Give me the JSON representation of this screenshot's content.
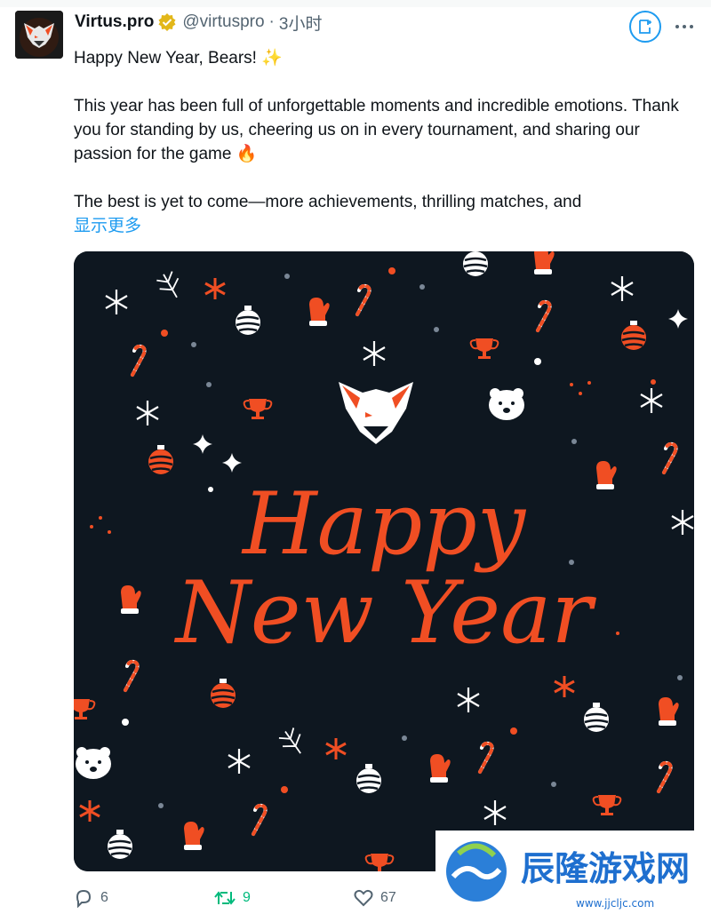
{
  "author": {
    "name": "Virtus.pro",
    "handle": "@virtuspro",
    "separator": "·",
    "time": "3小时",
    "avatar_icon": "vp-bear-logo"
  },
  "tweet": {
    "line1": "Happy New Year, Bears! ✨",
    "para2": "This year has been full of unforgettable moments and incredible emotions. Thank you for standing by us, cheering us on in every tournament, and sharing our passion for the game 🔥",
    "para3": "The best is yet to come—more achievements, thrilling matches, and",
    "show_more": "显示更多"
  },
  "media": {
    "greeting_line1": "Happy",
    "greeting_line2": "New Year",
    "background_color": "#0e1720",
    "accent_color": "#f04e23"
  },
  "actions": {
    "replies": "6",
    "retweets": "9",
    "likes": "67"
  },
  "watermark": {
    "brand": "辰隆游戏网",
    "url": "www.jjcljc.com"
  },
  "colors": {
    "link": "#1d9bf0",
    "retweet": "#00ba7c",
    "muted": "#536471",
    "verified": "#e2b719"
  }
}
